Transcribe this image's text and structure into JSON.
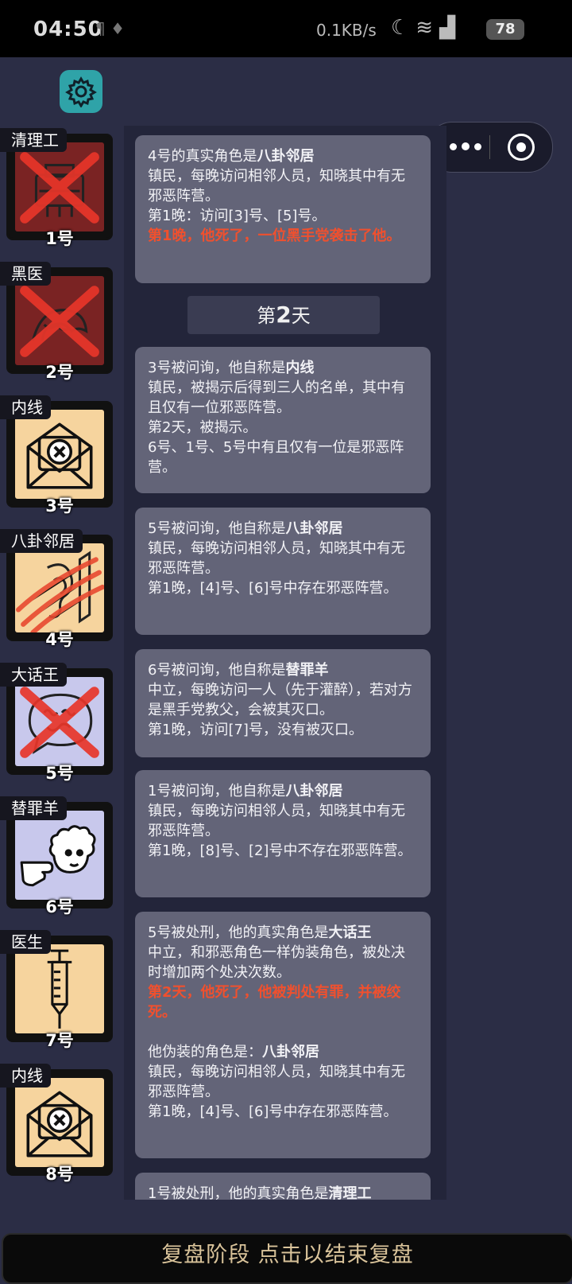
{
  "status_bar": {
    "time": "04:50",
    "extra_icons": "¶ ♦",
    "network_speed": "0.1KB/s",
    "battery": "78"
  },
  "settings": {
    "icon": "gear-icon"
  },
  "capsule": {
    "more_icon": "more-dots-icon",
    "close_icon": "target-close-icon"
  },
  "players": [
    {
      "role": "清理工",
      "number": "1号",
      "dead": true,
      "card_bg": "#7a2323"
    },
    {
      "role": "黑医",
      "number": "2号",
      "dead": true,
      "card_bg": "#7a2323"
    },
    {
      "role": "内线",
      "number": "3号",
      "dead": false,
      "card_bg": "#f6d49e"
    },
    {
      "role": "八卦邻居",
      "number": "4号",
      "dead": false,
      "card_bg": "#f6d49e"
    },
    {
      "role": "大话王",
      "number": "5号",
      "dead": true,
      "card_bg": "#c8c8ec"
    },
    {
      "role": "替罪羊",
      "number": "6号",
      "dead": false,
      "card_bg": "#c8c8ec"
    },
    {
      "role": "医生",
      "number": "7号",
      "dead": false,
      "card_bg": "#f6d49e"
    },
    {
      "role": "内线",
      "number": "8号",
      "dead": false,
      "card_bg": "#f6d49e"
    }
  ],
  "log": {
    "entry1": {
      "prefix": "4号的真实角色是",
      "role": "八卦邻居",
      "desc": "镇民，每晚访问相邻人员，知晓其中有无邪恶阵营。",
      "line": "第1晚：访问[3]号、[5]号。",
      "death": "第1晚，他死了，一位黑手党袭击了他。"
    },
    "day_prefix": "第",
    "day_number": "2",
    "day_suffix": "天",
    "entry2": {
      "prefix": "3号被问询，他自称是",
      "role": "内线",
      "desc": "镇民，被揭示后得到三人的名单，其中有且仅有一位邪恶阵营。",
      "line1": "第2天，被揭示。",
      "line2": "6号、1号、5号中有且仅有一位是邪恶阵营。"
    },
    "entry3": {
      "prefix": "5号被问询，他自称是",
      "role": "八卦邻居",
      "desc": "镇民，每晚访问相邻人员，知晓其中有无邪恶阵营。",
      "line": "第1晚，[4]号、[6]号中存在邪恶阵营。"
    },
    "entry4": {
      "prefix": "6号被问询，他自称是",
      "role": "替罪羊",
      "desc": "中立，每晚访问一人（先于灌醉），若对方是黑手党教父，会被其灭口。",
      "line": "第1晚，访问[7]号，没有被灭口。"
    },
    "entry5": {
      "prefix": "1号被问询，他自称是",
      "role": "八卦邻居",
      "desc": "镇民，每晚访问相邻人员，知晓其中有无邪恶阵营。",
      "line": "第1晚，[8]号、[2]号中不存在邪恶阵营。"
    },
    "entry6": {
      "prefix": "5号被处刑，他的真实角色是",
      "role": "大话王",
      "desc": "中立，和邪恶角色一样伪装角色，被处决时增加两个处决次数。",
      "death": "第2天，他死了，他被判处有罪，并被绞死。",
      "fake_prefix": "他伪装的角色是：",
      "fake_role": "八卦邻居",
      "fake_desc": "镇民，每晚访问相邻人员，知晓其中有无邪恶阵营。",
      "fake_line": "第1晚，[4]号、[6]号中存在邪恶阵营。"
    },
    "entry7": {
      "prefix": "1号被处刑，他的真实角色是",
      "role": "清理工"
    }
  },
  "bottom_bar": {
    "label": "复盘阶段 点击以结束复盘"
  }
}
